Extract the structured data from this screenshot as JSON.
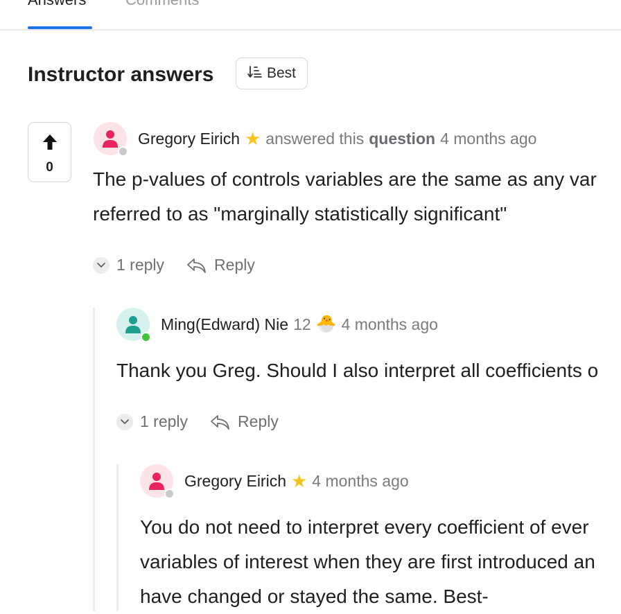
{
  "tabs": [
    {
      "label": "Answers",
      "active": true
    },
    {
      "label": "Comments",
      "active": false
    }
  ],
  "section": {
    "title": "Instructor answers",
    "sort_label": "Best"
  },
  "answer": {
    "votes": "0",
    "author": "Gregory Eirich",
    "action_text": "answered this",
    "object_text": "question",
    "time": "4 months ago",
    "body_lines": [
      "The p-values of controls variables are the same as any var",
      "referred to as \"marginally statistically significant\""
    ],
    "reply_count": "1 reply",
    "reply_label": "Reply"
  },
  "reply1": {
    "author": "Ming(Edward) Nie",
    "score": "12",
    "badge": "🐣",
    "time": "4 months ago",
    "body_lines": [
      "Thank you Greg. Should I also interpret all coefficients o"
    ],
    "reply_count": "1 reply",
    "reply_label": "Reply"
  },
  "reply2": {
    "author": "Gregory Eirich",
    "time": "4 months ago",
    "body_lines": [
      "You do not need to interpret every coefficient of ever",
      "variables of interest when they are first introduced an",
      "have changed or stayed the same.  Best-"
    ]
  },
  "colors": {
    "accent": "#1a73e8",
    "star": "#f6c31a",
    "avatar_pink": "#e8245e",
    "avatar_teal": "#1e9e8f",
    "online": "#3ac43a",
    "offline": "#c9c9cd"
  }
}
